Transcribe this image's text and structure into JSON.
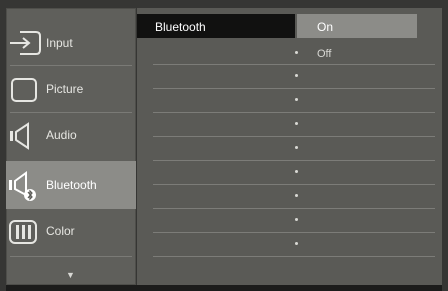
{
  "menu": {
    "items": [
      {
        "label": "Input",
        "icon": "input-icon",
        "active": false
      },
      {
        "label": "Picture",
        "icon": "picture-icon",
        "active": false
      },
      {
        "label": "Audio",
        "icon": "audio-icon",
        "active": false
      },
      {
        "label": "Bluetooth",
        "icon": "bluetooth-icon",
        "active": true
      },
      {
        "label": "Color",
        "icon": "color-icon",
        "active": false
      }
    ],
    "scroll_icon": "chevron-down-icon",
    "scroll_glyph": "▼"
  },
  "panel": {
    "setting_label": "Bluetooth",
    "options": [
      {
        "label": "On",
        "selected": true
      },
      {
        "label": "Off",
        "selected": false
      }
    ]
  },
  "colors": {
    "background": "#363634",
    "menu_bg": "#5f5f5b",
    "active_item": "#8c8c88",
    "setting_label_bg": "#111110"
  }
}
